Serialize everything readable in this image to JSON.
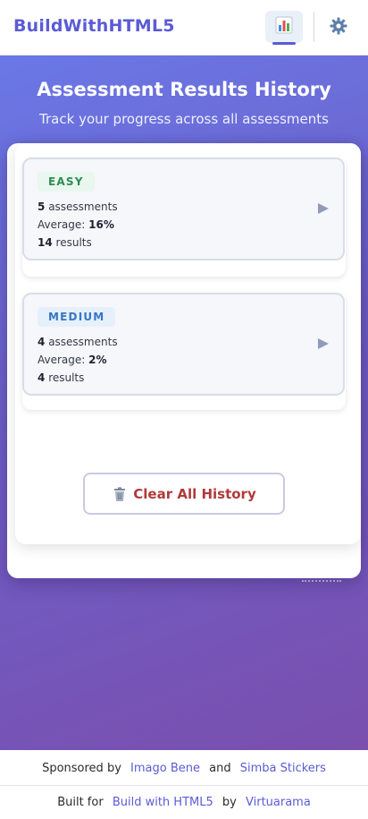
{
  "header": {
    "brand": "BuildWithHTML5",
    "chart_icon": "bar-chart-icon",
    "settings_icon": "gear-icon"
  },
  "hero": {
    "title": "Assessment Results History",
    "subtitle": "Track your progress across all assessments"
  },
  "groups": [
    {
      "level": "EASY",
      "assessments_count": "5",
      "assessments_label": "assessments",
      "average_label": "Average:",
      "average_value": "16%",
      "results_count": "14",
      "results_label": "results",
      "arrow_icon": "play-arrow-icon"
    },
    {
      "level": "MEDIUM",
      "assessments_count": "4",
      "assessments_label": "assessments",
      "average_label": "Average:",
      "average_value": "2%",
      "results_count": "4",
      "results_label": "results",
      "arrow_icon": "play-arrow-icon"
    }
  ],
  "actions": {
    "clear_label": "Clear All History",
    "clear_icon": "trash-icon"
  },
  "footer": {
    "sponsored_by": "Sponsored by",
    "sponsor1": "Imago Bene",
    "and": "and",
    "sponsor2": "Simba Stickers",
    "built_for": "Built for",
    "built_link": "Build with HTML5",
    "by": "by",
    "author": "Virtuarama"
  },
  "colors": {
    "brand": "#5b5bd6",
    "gradient_start": "#6a78e6",
    "gradient_end": "#7a4fae",
    "easy": "#2e8b57",
    "medium": "#3577c2",
    "danger": "#b03a3a"
  }
}
